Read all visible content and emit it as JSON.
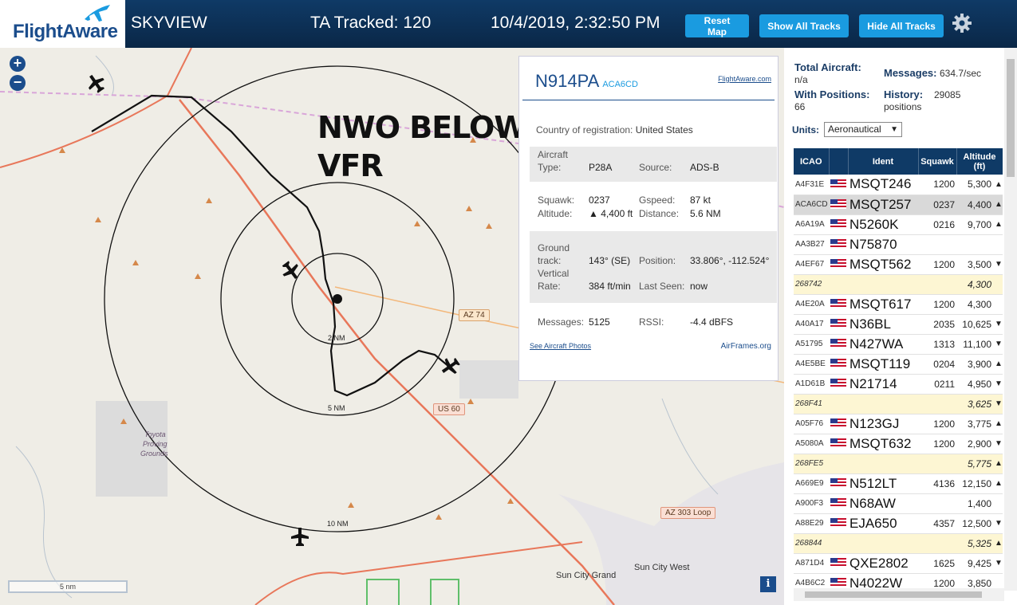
{
  "header": {
    "logo": "FlightAware",
    "app_name": "SKYVIEW",
    "tracked": "TA Tracked: 120",
    "datetime": "10/4/2019, 2:32:50 PM",
    "buttons": {
      "reset": "Reset Map",
      "show": "Show All Tracks",
      "hide": "Hide All Tracks"
    },
    "icons": {
      "logo": "plane-icon",
      "settings": "gear-icon"
    }
  },
  "map": {
    "zoom_in": "+",
    "zoom_out": "−",
    "annotation_line1": "NWO BELOW",
    "annotation_line2": "VFR",
    "rings": {
      "r2": "2 NM",
      "r5": "5 NM",
      "r10": "10 NM"
    },
    "roads": {
      "az74": "AZ 74",
      "us60": "US 60",
      "az303": "AZ 303 Loop"
    },
    "places": {
      "toyota1": "Toyota",
      "toyota2": "Proving",
      "toyota3": "Grounds",
      "suncity": "Sun City Grand",
      "suncitywest": "Sun City West"
    },
    "scale": "5 nm",
    "info": "i"
  },
  "popup": {
    "registration": "N914PA",
    "icao": "ACA6CD",
    "link": "FlightAware.com",
    "country_label": "Country of registration:",
    "country": "United States",
    "aircraft_type_label_1": "Aircraft",
    "aircraft_type_label_2": "Type:",
    "aircraft_type": "P28A",
    "source_label": "Source:",
    "source": "ADS-B",
    "squawk_label": "Squawk:",
    "squawk": "0237",
    "gspeed_label": "Gspeed:",
    "gspeed": "87 kt",
    "altitude_label": "Altitude:",
    "altitude": "▲ 4,400 ft",
    "distance_label": "Distance:",
    "distance": "5.6 NM",
    "track_label_1": "Ground",
    "track_label_2": "track:",
    "track": "143° (SE)",
    "position_label": "Position:",
    "position": "33.806°, -112.524°",
    "vrate_label_1": "Vertical",
    "vrate_label_2": "Rate:",
    "vrate": "384 ft/min",
    "lastseen_label": "Last Seen:",
    "lastseen": "now",
    "messages_label": "Messages:",
    "messages": "5125",
    "rssi_label": "RSSI:",
    "rssi": "-4.4 dBFS",
    "photos_link": "See Aircraft Photos",
    "airframes_link": "AirFrames.org"
  },
  "sidebar": {
    "total_label": "Total Aircraft:",
    "total": "n/a",
    "messages_label": "Messages:",
    "messages": "634.7/sec",
    "withpos_label": "With Positions:",
    "withpos": "66",
    "history_label": "History:",
    "history_1": "29085",
    "history_2": "positions",
    "units_label": "Units:",
    "units_value": "Aeronautical",
    "columns": {
      "icao": "ICAO",
      "ident": "Ident",
      "squawk": "Squawk",
      "alt1": "Altitude",
      "alt2": "(ft)"
    },
    "rows": [
      {
        "icao": "A4F31E",
        "flag": true,
        "ident": "MSQT246",
        "squawk": "1200",
        "alt": "5,300",
        "trend": "▲",
        "kind": "norm"
      },
      {
        "icao": "ACA6CD",
        "flag": true,
        "ident": "MSQT257",
        "squawk": "0237",
        "alt": "4,400",
        "trend": "▲",
        "kind": "sel"
      },
      {
        "icao": "A6A19A",
        "flag": true,
        "ident": "N5260K",
        "squawk": "0216",
        "alt": "9,700",
        "trend": "▲",
        "kind": "norm"
      },
      {
        "icao": "AA3B27",
        "flag": true,
        "ident": "N75870",
        "squawk": "",
        "alt": "",
        "trend": "",
        "kind": "norm"
      },
      {
        "icao": "A4EF67",
        "flag": true,
        "ident": "MSQT562",
        "squawk": "1200",
        "alt": "3,500",
        "trend": "▼",
        "kind": "norm"
      },
      {
        "icao": "268742",
        "flag": false,
        "ident": "",
        "squawk": "",
        "alt": "4,300",
        "trend": "",
        "kind": "nopos"
      },
      {
        "icao": "A4E20A",
        "flag": true,
        "ident": "MSQT617",
        "squawk": "1200",
        "alt": "4,300",
        "trend": "",
        "kind": "norm"
      },
      {
        "icao": "A40A17",
        "flag": true,
        "ident": "N36BL",
        "squawk": "2035",
        "alt": "10,625",
        "trend": "▼",
        "kind": "norm"
      },
      {
        "icao": "A51795",
        "flag": true,
        "ident": "N427WA",
        "squawk": "1313",
        "alt": "11,100",
        "trend": "▼",
        "kind": "norm"
      },
      {
        "icao": "A4E5BE",
        "flag": true,
        "ident": "MSQT119",
        "squawk": "0204",
        "alt": "3,900",
        "trend": "▲",
        "kind": "norm"
      },
      {
        "icao": "A1D61B",
        "flag": true,
        "ident": "N21714",
        "squawk": "0211",
        "alt": "4,950",
        "trend": "▼",
        "kind": "norm"
      },
      {
        "icao": "268F41",
        "flag": false,
        "ident": "",
        "squawk": "",
        "alt": "3,625",
        "trend": "▼",
        "kind": "nopos"
      },
      {
        "icao": "A05F76",
        "flag": true,
        "ident": "N123GJ",
        "squawk": "1200",
        "alt": "3,775",
        "trend": "▲",
        "kind": "norm"
      },
      {
        "icao": "A5080A",
        "flag": true,
        "ident": "MSQT632",
        "squawk": "1200",
        "alt": "2,900",
        "trend": "▼",
        "kind": "norm"
      },
      {
        "icao": "268FE5",
        "flag": false,
        "ident": "",
        "squawk": "",
        "alt": "5,775",
        "trend": "▲",
        "kind": "nopos"
      },
      {
        "icao": "A669E9",
        "flag": true,
        "ident": "N512LT",
        "squawk": "4136",
        "alt": "12,150",
        "trend": "▲",
        "kind": "norm"
      },
      {
        "icao": "A900F3",
        "flag": true,
        "ident": "N68AW",
        "squawk": "",
        "alt": "1,400",
        "trend": "",
        "kind": "norm"
      },
      {
        "icao": "A88E29",
        "flag": true,
        "ident": "EJA650",
        "squawk": "4357",
        "alt": "12,500",
        "trend": "▼",
        "kind": "norm"
      },
      {
        "icao": "268844",
        "flag": false,
        "ident": "",
        "squawk": "",
        "alt": "5,325",
        "trend": "▲",
        "kind": "nopos"
      },
      {
        "icao": "A871D4",
        "flag": true,
        "ident": "QXE2802",
        "squawk": "1625",
        "alt": "9,425",
        "trend": "▼",
        "kind": "norm"
      },
      {
        "icao": "A4B6C2",
        "flag": true,
        "ident": "N4022W",
        "squawk": "1200",
        "alt": "3,850",
        "trend": "",
        "kind": "norm"
      }
    ]
  },
  "colors": {
    "header_bg": "#0f3a66",
    "button_bg": "#1a9be0",
    "selected_row": "#d9d9d9",
    "no_position_row": "#fdf6d3",
    "track_line": "#000000",
    "highway": "#e8775a",
    "airspace_boundary": "#d9a6d9"
  }
}
